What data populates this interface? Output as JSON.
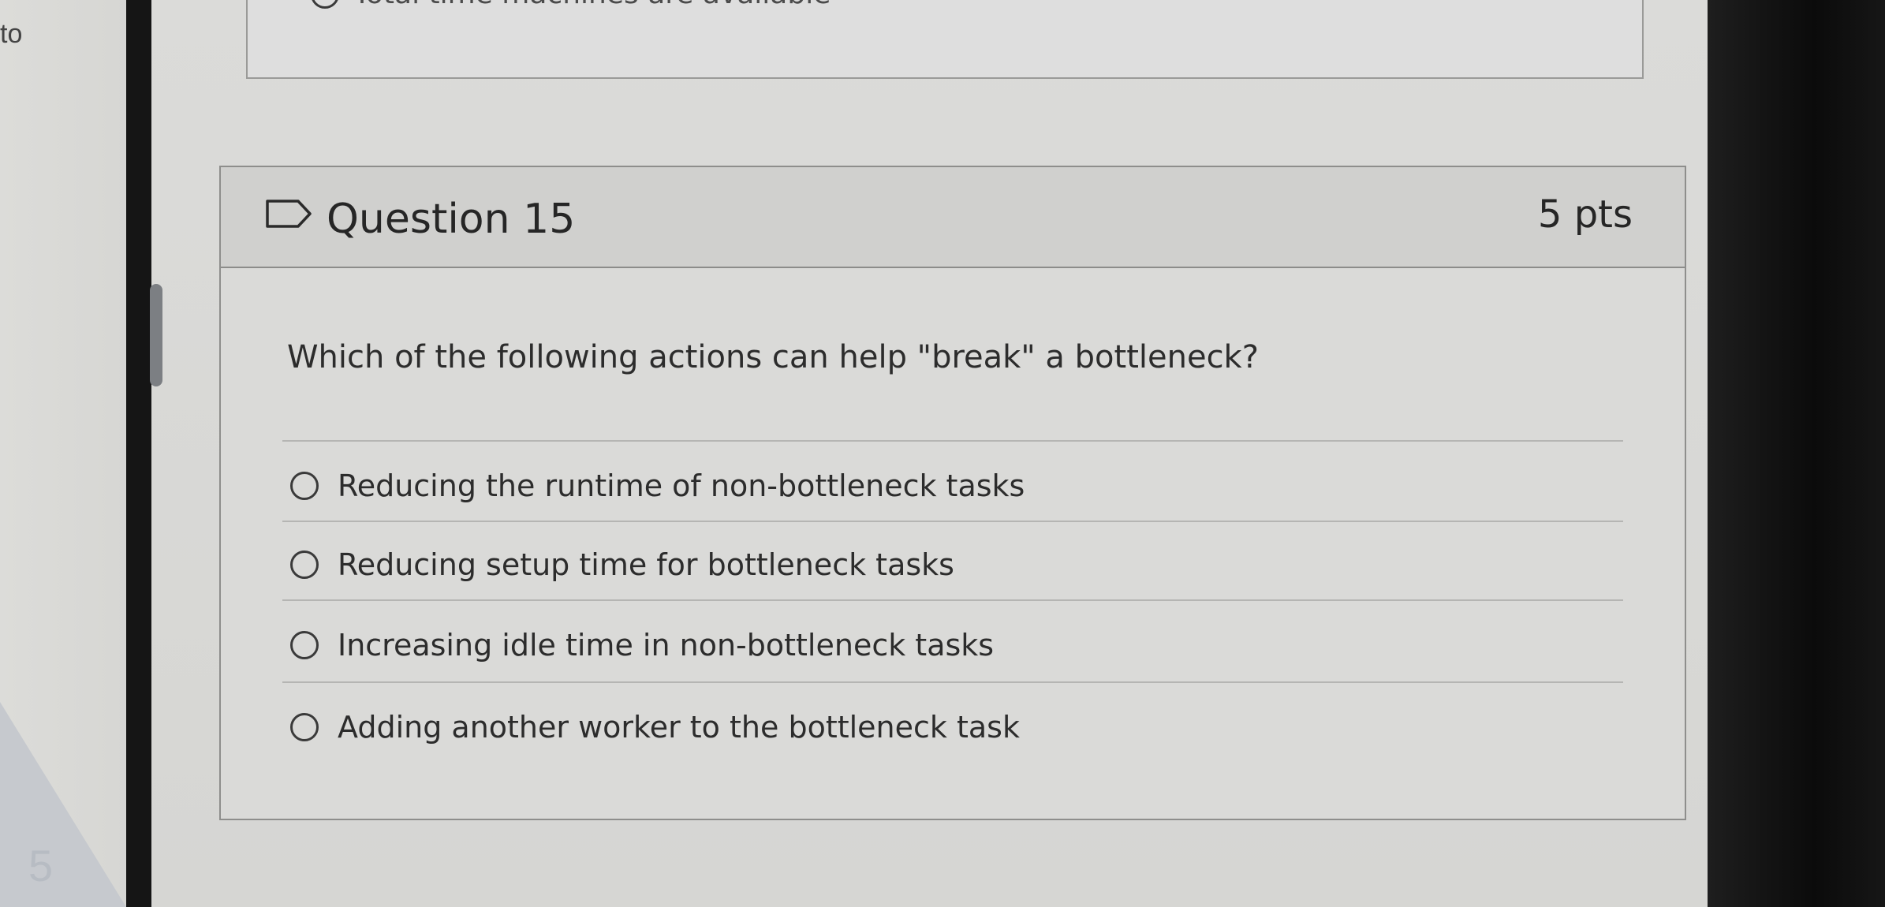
{
  "left_edge": {
    "text": "to",
    "number": "5"
  },
  "previous_question": {
    "option_label": "Total time machines are available"
  },
  "question": {
    "title": "Question 15",
    "points": "5 pts",
    "prompt": "Which of the following actions can help \"break\" a bottleneck?",
    "answers": [
      {
        "label": "Reducing the runtime of non-bottleneck tasks",
        "selected": false
      },
      {
        "label": "Reducing setup time for bottleneck tasks",
        "selected": false
      },
      {
        "label": "Increasing idle time in non-bottleneck tasks",
        "selected": false
      },
      {
        "label": "Adding another worker to the bottleneck task",
        "selected": false
      }
    ]
  },
  "icons": {
    "bookmark": "bookmark-flag-icon",
    "radio": "radio-button-icon"
  }
}
